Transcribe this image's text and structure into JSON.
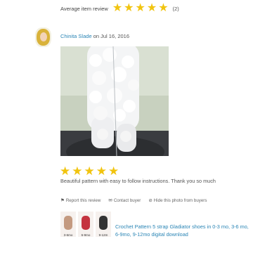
{
  "summary": {
    "label": "Average item review",
    "rating": 5,
    "count": "(2)",
    "star_color": "#f1c40f"
  },
  "review": {
    "reviewer": "Chinita Slade",
    "date_prefix": " on ",
    "date": "Jul 16, 2016",
    "rating": 5,
    "text": "Beautiful pattern with easy to follow instructions. Thank you so much",
    "actions": {
      "report": "Report this review",
      "contact": "Contact buyer",
      "hide_photo": "Hide this photo from buyers"
    }
  },
  "product": {
    "title": "Crochet Pattern 5 strap Gladiator shoes in 0-3 mo, 3-6 mo, 6-9mo, 9-12mo digital download",
    "thumbnail_sizes": [
      "3-6mo",
      "6-9mo",
      "9-12m"
    ],
    "thumbnail_colors": [
      "#c49a80",
      "#c4333f",
      "#333333"
    ]
  },
  "colors": {
    "link": "#2a85b5",
    "text": "#555555"
  }
}
